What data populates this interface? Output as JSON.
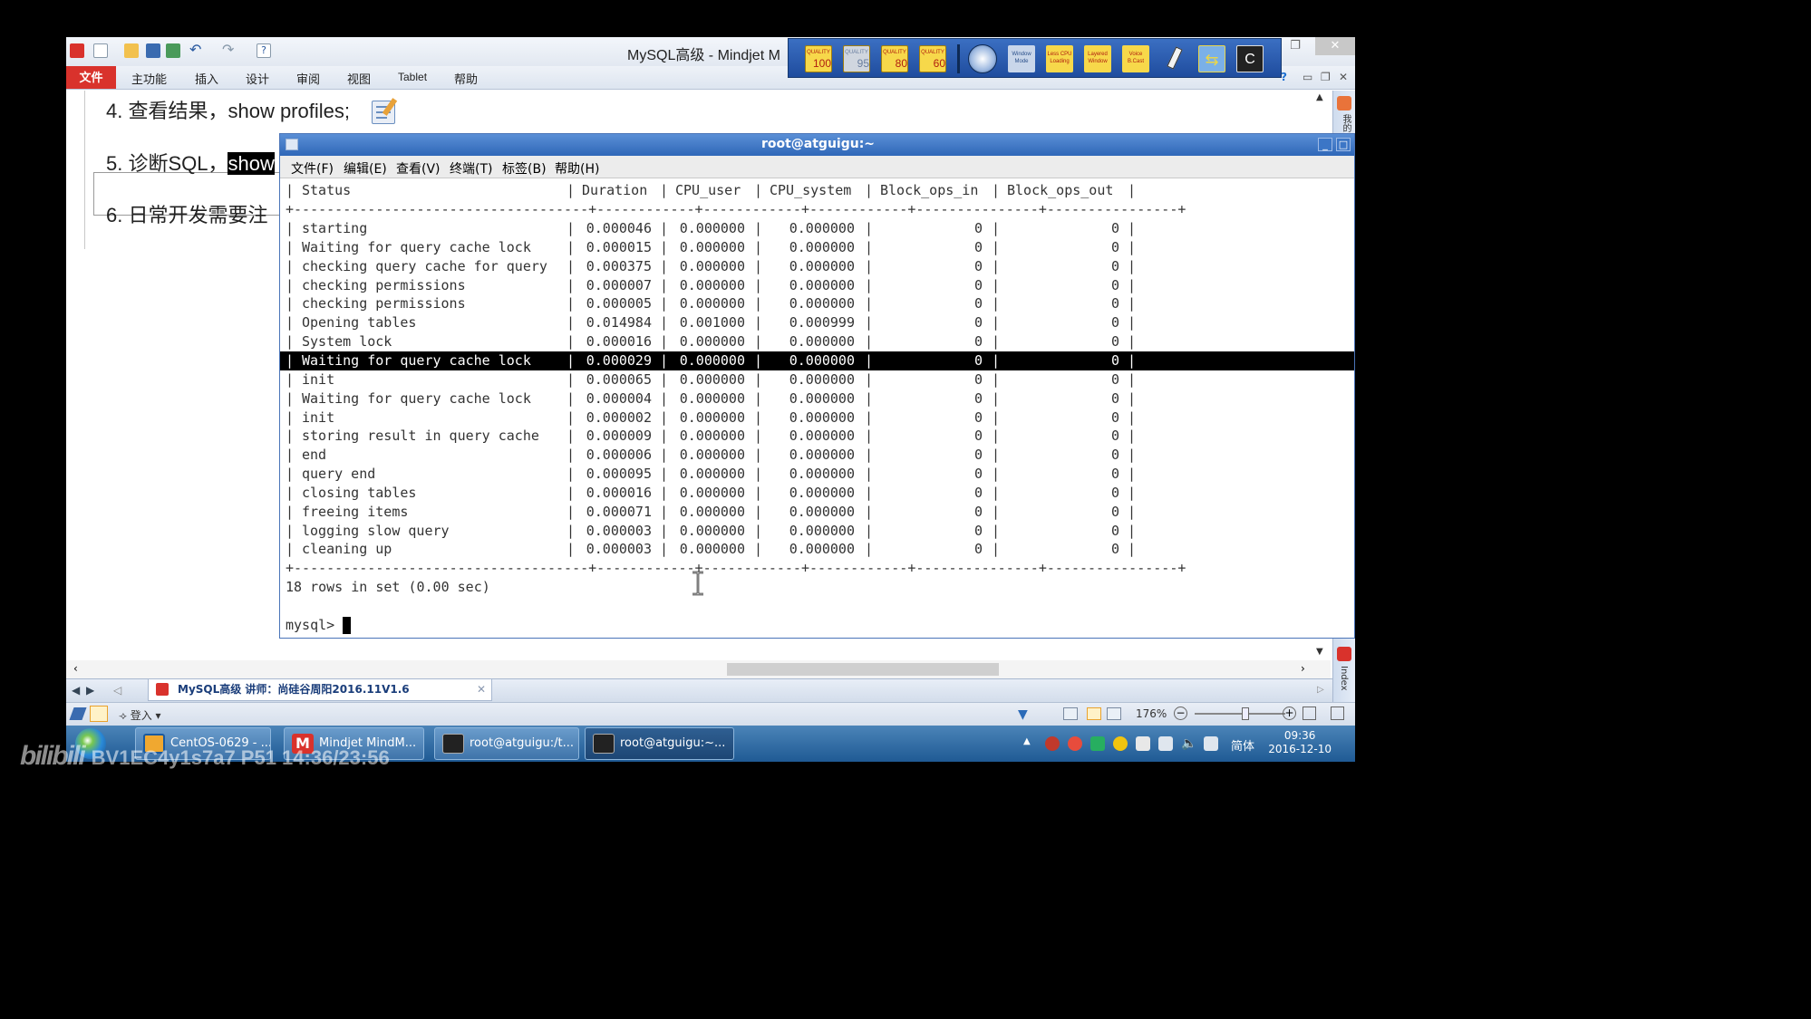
{
  "app": {
    "title": "MySQL高级 - Mindjet M",
    "ribbon_tabs": [
      "文件",
      "主功能",
      "插入",
      "设计",
      "审阅",
      "视图",
      "Tablet",
      "帮助"
    ]
  },
  "rec_toolbar": {
    "quality": [
      {
        "label": "QUALITY",
        "value": "100"
      },
      {
        "label": "QUALITY",
        "value": "95"
      },
      {
        "label": "QUALITY",
        "value": "80"
      },
      {
        "label": "QUALITY",
        "value": "60"
      }
    ],
    "buttons": [
      "Window Mode",
      "Less CPU Loading",
      "Layered Window",
      "Voice B.Cast"
    ]
  },
  "map": {
    "topics": [
      {
        "prefix": "4. 查看结果，",
        "text": "show profiles;"
      },
      {
        "prefix": "5. 诊断SQL，",
        "highlight": "show"
      },
      {
        "prefix": "6. 日常开发需要注"
      }
    ]
  },
  "doc_tab": {
    "label": "MySQL高级 讲师：尚硅谷周阳2016.11V1.6"
  },
  "statusbar": {
    "login": "登入",
    "zoom": "176%"
  },
  "side_panel": {
    "top": "我的",
    "bottom": "Index"
  },
  "terminal": {
    "title": "root@atguigu:~",
    "menu": [
      "文件(F)",
      "编辑(E)",
      "查看(V)",
      "终端(T)",
      "标签(B)",
      "帮助(H)"
    ],
    "columns": [
      "Status",
      "Duration",
      "CPU_user",
      "CPU_system",
      "Block_ops_in",
      "Block_ops_out"
    ],
    "rows": [
      [
        "starting",
        "0.000046",
        "0.000000",
        "0.000000",
        "0",
        "0"
      ],
      [
        "Waiting for query cache lock",
        "0.000015",
        "0.000000",
        "0.000000",
        "0",
        "0"
      ],
      [
        "checking query cache for query",
        "0.000375",
        "0.000000",
        "0.000000",
        "0",
        "0"
      ],
      [
        "checking permissions",
        "0.000007",
        "0.000000",
        "0.000000",
        "0",
        "0"
      ],
      [
        "checking permissions",
        "0.000005",
        "0.000000",
        "0.000000",
        "0",
        "0"
      ],
      [
        "Opening tables",
        "0.014984",
        "0.001000",
        "0.000999",
        "0",
        "0"
      ],
      [
        "System lock",
        "0.000016",
        "0.000000",
        "0.000000",
        "0",
        "0"
      ],
      [
        "Waiting for query cache lock",
        "0.000029",
        "0.000000",
        "0.000000",
        "0",
        "0"
      ],
      [
        "init",
        "0.000065",
        "0.000000",
        "0.000000",
        "0",
        "0"
      ],
      [
        "Waiting for query cache lock",
        "0.000004",
        "0.000000",
        "0.000000",
        "0",
        "0"
      ],
      [
        "init",
        "0.000002",
        "0.000000",
        "0.000000",
        "0",
        "0"
      ],
      [
        "storing result in query cache",
        "0.000009",
        "0.000000",
        "0.000000",
        "0",
        "0"
      ],
      [
        "end",
        "0.000006",
        "0.000000",
        "0.000000",
        "0",
        "0"
      ],
      [
        "query end",
        "0.000095",
        "0.000000",
        "0.000000",
        "0",
        "0"
      ],
      [
        "closing tables",
        "0.000016",
        "0.000000",
        "0.000000",
        "0",
        "0"
      ],
      [
        "freeing items",
        "0.000071",
        "0.000000",
        "0.000000",
        "0",
        "0"
      ],
      [
        "logging slow query",
        "0.000003",
        "0.000000",
        "0.000000",
        "0",
        "0"
      ],
      [
        "cleaning up",
        "0.000003",
        "0.000000",
        "0.000000",
        "0",
        "0"
      ]
    ],
    "selected_row": 7,
    "summary": "18 rows in set (0.00 sec)",
    "prompt": "mysql> "
  },
  "taskbar": {
    "tasks": [
      {
        "label": "CentOS-0629 - ...",
        "icon": "vmware-icon"
      },
      {
        "label": "Mindjet MindM...",
        "icon": "mindjet-icon"
      },
      {
        "label": "root@atguigu:/t...",
        "icon": "terminal-icon"
      },
      {
        "label": "root@atguigu:~...",
        "icon": "terminal-icon"
      }
    ],
    "lang": "简体",
    "time": "09:36",
    "date": "2016-12-10"
  },
  "watermark": {
    "logo": "bilibili",
    "text": "BV1EC4y1s7a7 P51 14:36/23:56"
  }
}
